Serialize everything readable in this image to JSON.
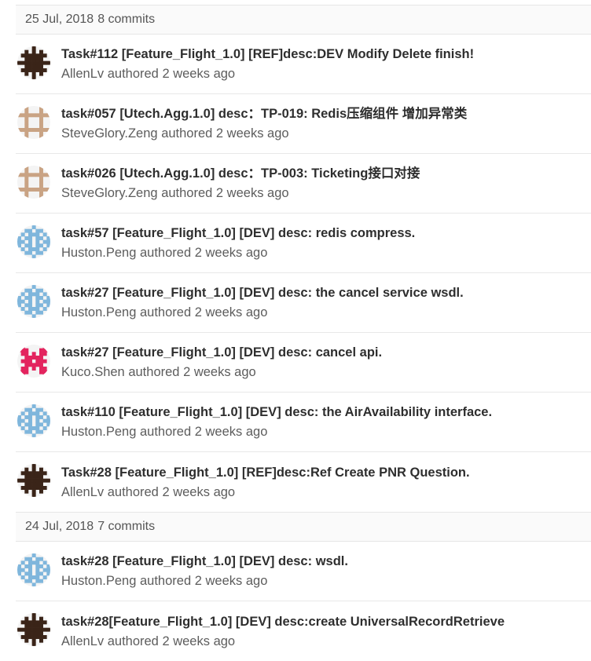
{
  "groups": [
    {
      "date": "25 Jul, 2018",
      "count": "8 commits",
      "commits": [
        {
          "title": "Task#112 [Feature_Flight_1.0] [REF]desc:DEV Modify Delete finish!",
          "author": "AllenLv",
          "action": "authored",
          "time": "2 weeks ago",
          "avatar": "allen"
        },
        {
          "title": "task#057 [Utech.Agg.1.0] desc：TP-019: Redis压缩组件 增加异常类",
          "author": "SteveGlory.Zeng",
          "action": "authored",
          "time": "2 weeks ago",
          "avatar": "steve"
        },
        {
          "title": "task#026 [Utech.Agg.1.0] desc：TP-003: Ticketing接口对接",
          "author": "SteveGlory.Zeng",
          "action": "authored",
          "time": "2 weeks ago",
          "avatar": "steve"
        },
        {
          "title": "task#57 [Feature_Flight_1.0] [DEV] desc: redis compress.",
          "author": "Huston.Peng",
          "action": "authored",
          "time": "2 weeks ago",
          "avatar": "huston"
        },
        {
          "title": "task#27 [Feature_Flight_1.0] [DEV] desc: the cancel service wsdl.",
          "author": "Huston.Peng",
          "action": "authored",
          "time": "2 weeks ago",
          "avatar": "huston"
        },
        {
          "title": "task#27 [Feature_Flight_1.0] [DEV] desc: cancel api.",
          "author": "Kuco.Shen",
          "action": "authored",
          "time": "2 weeks ago",
          "avatar": "kuco"
        },
        {
          "title": "task#110 [Feature_Flight_1.0] [DEV] desc: the AirAvailability interface.",
          "author": "Huston.Peng",
          "action": "authored",
          "time": "2 weeks ago",
          "avatar": "huston"
        },
        {
          "title": "Task#28 [Feature_Flight_1.0] [REF]desc:Ref Create PNR Question.",
          "author": "AllenLv",
          "action": "authored",
          "time": "2 weeks ago",
          "avatar": "allen"
        }
      ]
    },
    {
      "date": "24 Jul, 2018",
      "count": "7 commits",
      "commits": [
        {
          "title": "task#28 [Feature_Flight_1.0] [DEV] desc: wsdl.",
          "author": "Huston.Peng",
          "action": "authored",
          "time": "2 weeks ago",
          "avatar": "huston"
        },
        {
          "title": "task#28[Feature_Flight_1.0] [DEV] desc:create UniversalRecordRetrieve",
          "author": "AllenLv",
          "action": "authored",
          "time": "2 weeks ago",
          "avatar": "allen"
        }
      ]
    }
  ],
  "avatar_colors": {
    "allen": "#3a2418",
    "steve": "#c9a384",
    "huston": "#7fb6dc",
    "kuco": "#e3245e"
  }
}
